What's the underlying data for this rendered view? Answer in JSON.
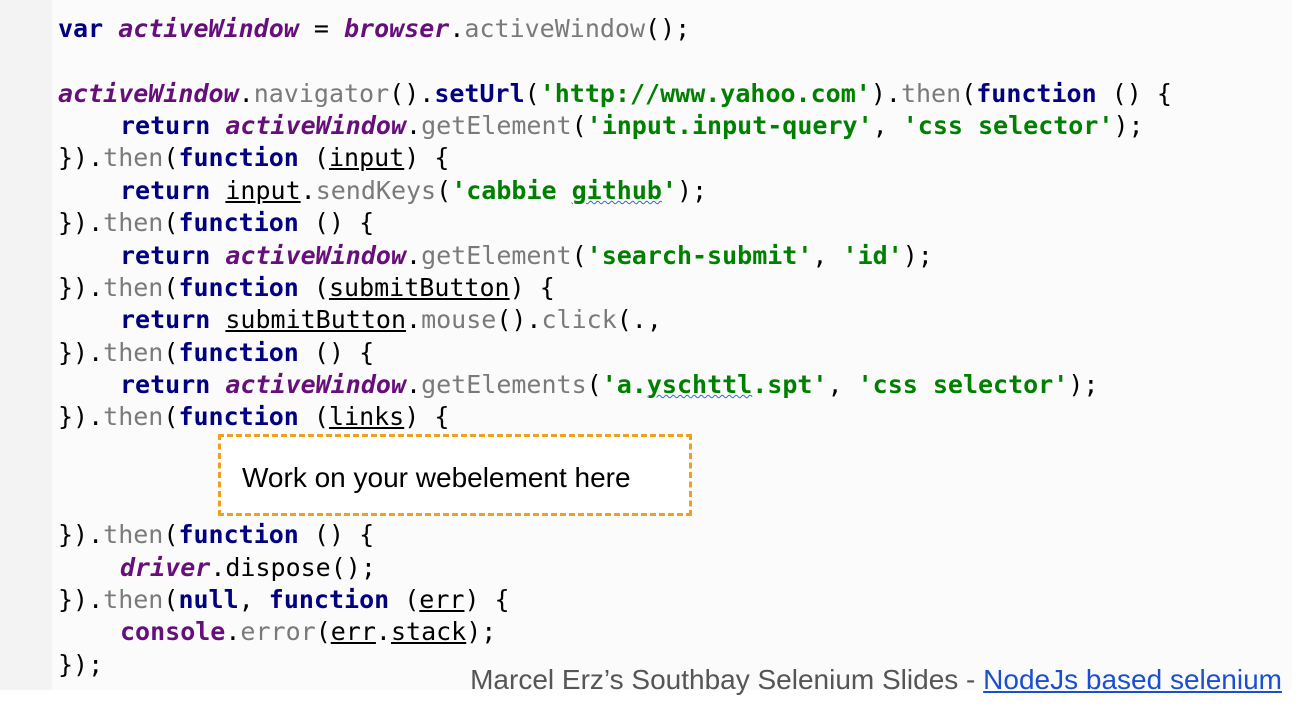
{
  "code": {
    "line1": {
      "kw": "var",
      "var": "activeWindow",
      "eq": " = ",
      "obj": "browser",
      "dot": ".",
      "fn": "activeWindow",
      "end": "();"
    },
    "line2": {
      "obj": "activeWindow",
      "dot1": ".",
      "fn1": "navigator",
      "p1": "().",
      "fn2": "setUrl",
      "p2": "(",
      "str": "'http://www.yahoo.com'",
      "p3": ").",
      "fn3": "then",
      "p4": "(",
      "kw": "function",
      "end": " () {"
    },
    "line3": {
      "kw": "return",
      "obj": "activeWindow",
      "dot": ".",
      "fn": "getElement",
      "p1": "(",
      "str1": "'input.input-query'",
      "comma": ", ",
      "str2": "'css selector'",
      "end": ");"
    },
    "line4": {
      "start": "}).",
      "fn": "then",
      "p1": "(",
      "kw": "function",
      "p2": " (",
      "param": "input",
      "end": ") {"
    },
    "line5": {
      "kw": "return",
      "param": "input",
      "dot": ".",
      "fn": "sendKeys",
      "p1": "(",
      "str1": "'cabbie ",
      "str2": "github",
      "str3": "'",
      "end": ");"
    },
    "line6": {
      "start": "}).",
      "fn": "then",
      "p1": "(",
      "kw": "function",
      "end": " () {"
    },
    "line7": {
      "kw": "return",
      "obj": "activeWindow",
      "dot": ".",
      "fn": "getElement",
      "p1": "(",
      "str1": "'search-submit'",
      "comma": ", ",
      "str2": "'id'",
      "end": ");"
    },
    "line8": {
      "start": "}).",
      "fn": "then",
      "p1": "(",
      "kw": "function",
      "p2": " (",
      "param": "submitButton",
      "end": ") {"
    },
    "line9": {
      "kw": "return",
      "param": "submitButton",
      "dot": ".",
      "fn1": "mouse",
      "p1": "().",
      "fn2": "click",
      "end": "(.,"
    },
    "line10": {
      "start": "}).",
      "fn": "then",
      "p1": "(",
      "kw": "function",
      "end": " () {"
    },
    "line11": {
      "kw": "return",
      "obj": "activeWindow",
      "dot": ".",
      "fn": "getElements",
      "p1": "(",
      "str1": "'a.",
      "str2": "yschttl",
      "str3": ".spt'",
      "comma": ", ",
      "str4": "'css selector'",
      "end": ");"
    },
    "line12": {
      "start": "}).",
      "fn": "then",
      "p1": "(",
      "kw": "function",
      "p2": " (",
      "param": "links",
      "end": ") {"
    },
    "line13": {
      "start": "}).",
      "fn": "then",
      "p1": "(",
      "kw": "function",
      "end": " () {"
    },
    "line14": {
      "obj": "driver",
      "dot": ".",
      "fn": "dispose",
      "end": "();"
    },
    "line15": {
      "start": "}).",
      "fn": "then",
      "p1": "(",
      "kw1": "null",
      "comma": ", ",
      "kw2": "function",
      "p2": " (",
      "param": "err",
      "end": ") {"
    },
    "line16": {
      "obj": "console",
      "dot1": ".",
      "fn": "error",
      "p1": "(",
      "param": "err",
      "dot2": ".",
      "prop": "stack",
      "end": ");"
    },
    "line17": {
      "text": "});"
    }
  },
  "placeholder": {
    "text": "Work on your webelement here"
  },
  "caption": {
    "prefix": "Marcel Erz’s Southbay Selenium Slides - ",
    "link": "NodeJs based selenium"
  },
  "colors": {
    "keyword": "#000080",
    "variable": "#660e7a",
    "string": "#008000",
    "method": "#7a7a7a",
    "placeholder_border": "#f0a020",
    "link": "#1a4fd1"
  }
}
